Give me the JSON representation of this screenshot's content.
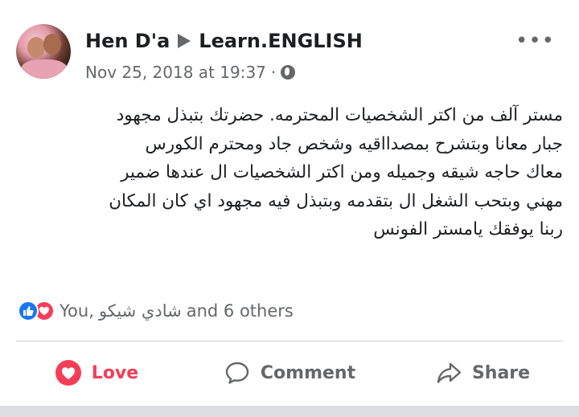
{
  "post": {
    "author": "Hen D'a",
    "group": "Learn.ENGLISH",
    "timestamp": "Nov 25, 2018 at 19:37",
    "separator": "·",
    "privacy_icon": "globe-icon",
    "more_icon": "more-dots-icon",
    "more_glyph": "•••",
    "body": "مستر آلف من اكتر الشخصيات المحترمه. حضرتك بتبذل مجهود\nجبار معانا وبتشرح بمصدااقيه وشخص جاد ومحترم الكورس\nمعاك حاجه شيقه وجميله ومن اكتر الشخصيات ال عندها ضمير\nمهني وبتحب الشغل ال بتقدمه وبتبذل فيه مجهود اي كان المكان\nربنا يوفقك يامستر الفونس"
  },
  "reactions": {
    "icons": [
      "like-icon",
      "love-icon"
    ],
    "you": "You,",
    "name": "شادي شيكو",
    "others": "and 6 others"
  },
  "actions": {
    "love_label": "Love",
    "comment_label": "Comment",
    "share_label": "Share"
  },
  "colors": {
    "love": "#f33e58",
    "like": "#1877f2",
    "text": "#1c1e21",
    "secondary": "#65676b"
  }
}
